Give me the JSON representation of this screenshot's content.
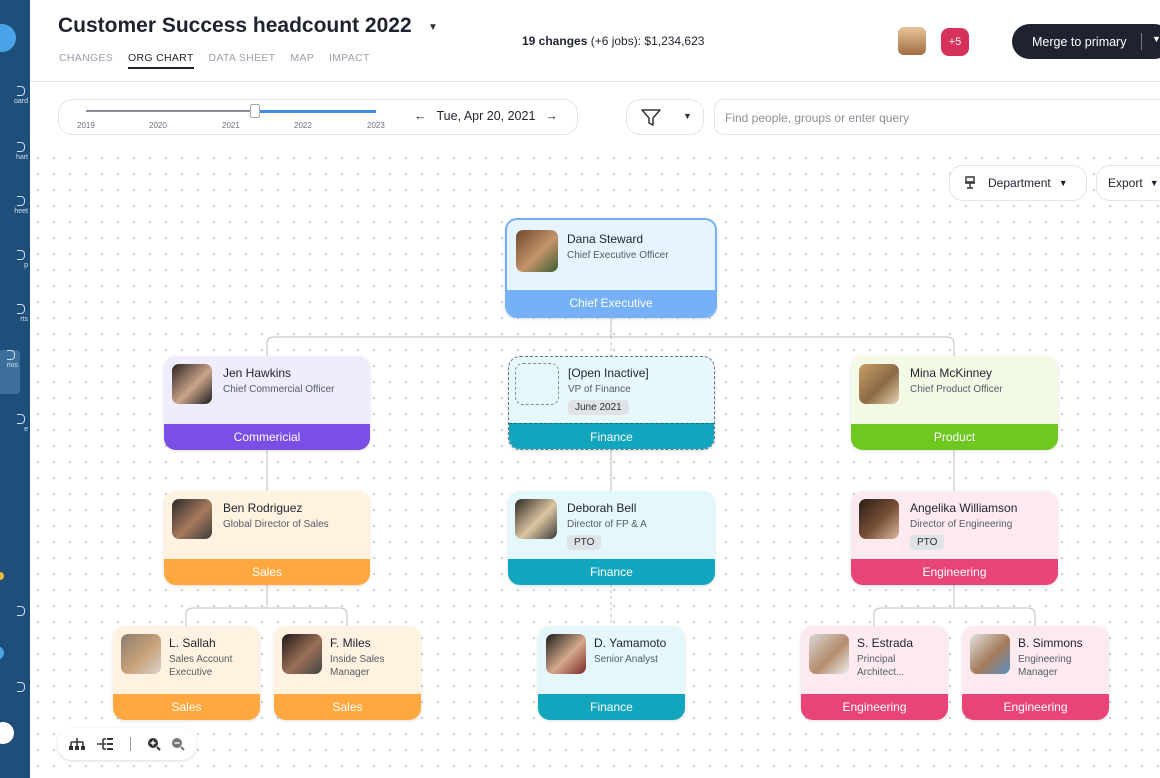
{
  "header": {
    "title": "Customer Success headcount 2022",
    "tabs": [
      "CHANGES",
      "ORG CHART",
      "DATA SHEET",
      "MAP",
      "IMPACT"
    ],
    "changes_bold": "19 changes",
    "changes_rest": " (+6 jobs): $1,234,623",
    "collaborators_more": "+5",
    "merge_label": "Merge to primary"
  },
  "sidebar": {
    "items": [
      "oard",
      "hart",
      "heet",
      "p",
      "rts",
      "rios",
      "e"
    ]
  },
  "timeline": {
    "years": [
      "2019",
      "2020",
      "2021",
      "2022",
      "2023"
    ],
    "date": "Tue, Apr 20, 2021",
    "prev_arrow": "←",
    "next_arrow": "→"
  },
  "search": {
    "placeholder": "Find people, groups or enter query"
  },
  "view": {
    "group_label": "Department",
    "export_label": "Export"
  },
  "colors": {
    "executive": "#76b1f7",
    "commercial": "#7b4ee6",
    "finance": "#12a5be",
    "product": "#6fc81f",
    "sales": "#ffa83f",
    "engineering": "#e84477"
  },
  "cards": [
    {
      "name": "Dana Steward",
      "role": "Chief Executive Officer",
      "dept": "Chief Executive"
    },
    {
      "name": "Jen Hawkins",
      "role": "Chief Commercial Officer",
      "dept": "Commericial"
    },
    {
      "name": "[Open Inactive]",
      "role": "VP of Finance",
      "badge": "June 2021",
      "dept": "Finance"
    },
    {
      "name": "Mina McKinney",
      "role": "Chief Product Officer",
      "dept": "Product"
    },
    {
      "name": "Ben Rodriguez",
      "role": "Global Director of Sales",
      "dept": "Sales"
    },
    {
      "name": "Deborah Bell",
      "role": "Director of FP & A",
      "badge": "PTO",
      "dept": "Finance"
    },
    {
      "name": "Angelika Williamson",
      "role": "Director of Engineering",
      "badge": "PTO",
      "dept": "Engineering"
    },
    {
      "name": "L. Sallah",
      "role_line1": "Sales Account",
      "role_line2": "Executive",
      "dept": "Sales"
    },
    {
      "name": "F. Miles",
      "role_line1": "Inside Sales",
      "role_line2": "Manager",
      "dept": "Sales"
    },
    {
      "name": "D. Yamamoto",
      "role": "Senior Analyst",
      "dept": "Finance"
    },
    {
      "name": "S. Estrada",
      "role_line1": "Principal",
      "role_line2": "Architect...",
      "dept": "Engineering"
    },
    {
      "name": "B. Simmons",
      "role_line1": "Engineering",
      "role_line2": "Manager",
      "dept": "Engineering"
    }
  ]
}
